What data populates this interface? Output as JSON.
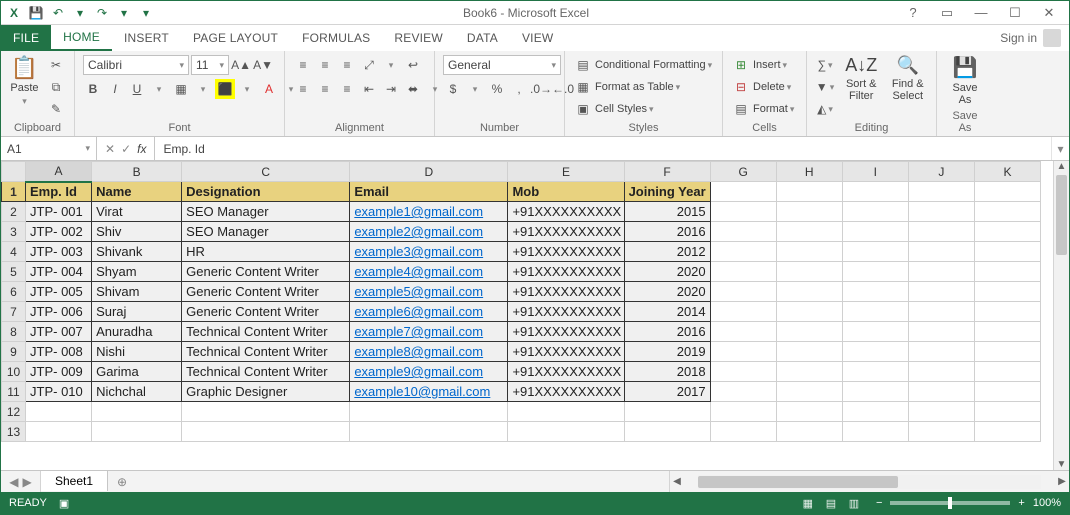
{
  "window": {
    "title": "Book6 - Microsoft Excel"
  },
  "qat": {
    "save": "save",
    "undo": "undo",
    "redo": "redo"
  },
  "tabs": {
    "file": "FILE",
    "home": "HOME",
    "insert": "INSERT",
    "pagelayout": "PAGE LAYOUT",
    "formulas": "FORMULAS",
    "review": "REVIEW",
    "data": "DATA",
    "view": "VIEW",
    "signin": "Sign in"
  },
  "ribbon": {
    "clipboard": {
      "paste": "Paste",
      "label": "Clipboard"
    },
    "font": {
      "name": "Calibri",
      "size": "11",
      "label": "Font"
    },
    "alignment": {
      "label": "Alignment"
    },
    "number": {
      "format": "General",
      "label": "Number"
    },
    "styles": {
      "cond": "Conditional Formatting",
      "table": "Format as Table",
      "cell": "Cell Styles",
      "label": "Styles"
    },
    "cells": {
      "insert": "Insert",
      "delete": "Delete",
      "format": "Format",
      "label": "Cells"
    },
    "editing": {
      "sort": "Sort & Filter",
      "find": "Find & Select",
      "label": "Editing"
    },
    "saveas": {
      "save": "Save As",
      "label": "Save As"
    }
  },
  "formulaBar": {
    "cellRef": "A1",
    "formula": "Emp. Id"
  },
  "columns": [
    "A",
    "B",
    "C",
    "D",
    "E",
    "F",
    "G",
    "H",
    "I",
    "J",
    "K"
  ],
  "headerRow": [
    "Emp. Id",
    "Name",
    "Designation",
    "Email",
    "Mob",
    "Joining Year"
  ],
  "data": [
    {
      "id": "JTP- 001",
      "name": "Virat",
      "desig": "SEO Manager",
      "email": "example1@gmail.com",
      "mob": "+91XXXXXXXXXX",
      "year": "2015"
    },
    {
      "id": "JTP- 002",
      "name": "Shiv",
      "desig": "SEO Manager",
      "email": "example2@gmail.com",
      "mob": "+91XXXXXXXXXX",
      "year": "2016"
    },
    {
      "id": "JTP- 003",
      "name": "Shivank",
      "desig": "HR",
      "email": "example3@gmail.com",
      "mob": "+91XXXXXXXXXX",
      "year": "2012"
    },
    {
      "id": "JTP- 004",
      "name": "Shyam",
      "desig": "Generic Content Writer",
      "email": "example4@gmail.com",
      "mob": "+91XXXXXXXXXX",
      "year": "2020"
    },
    {
      "id": "JTP- 005",
      "name": "Shivam",
      "desig": "Generic Content Writer",
      "email": "example5@gmail.com",
      "mob": "+91XXXXXXXXXX",
      "year": "2020"
    },
    {
      "id": "JTP- 006",
      "name": "Suraj",
      "desig": "Generic Content Writer",
      "email": "example6@gmail.com",
      "mob": "+91XXXXXXXXXX",
      "year": "2014"
    },
    {
      "id": "JTP- 007",
      "name": "Anuradha",
      "desig": "Technical Content Writer",
      "email": "example7@gmail.com",
      "mob": "+91XXXXXXXXXX",
      "year": "2016"
    },
    {
      "id": "JTP- 008",
      "name": "Nishi",
      "desig": "Technical Content Writer",
      "email": "example8@gmail.com",
      "mob": "+91XXXXXXXXXX",
      "year": "2019"
    },
    {
      "id": "JTP- 009",
      "name": "Garima",
      "desig": "Technical Content Writer",
      "email": "example9@gmail.com",
      "mob": "+91XXXXXXXXXX",
      "year": "2018"
    },
    {
      "id": "JTP- 010",
      "name": "Nichchal",
      "desig": "Graphic Designer",
      "email": "example10@gmail.com",
      "mob": "+91XXXXXXXXXX",
      "year": "2017"
    }
  ],
  "sheets": {
    "active": "Sheet1"
  },
  "status": {
    "ready": "READY",
    "zoom": "100%"
  }
}
